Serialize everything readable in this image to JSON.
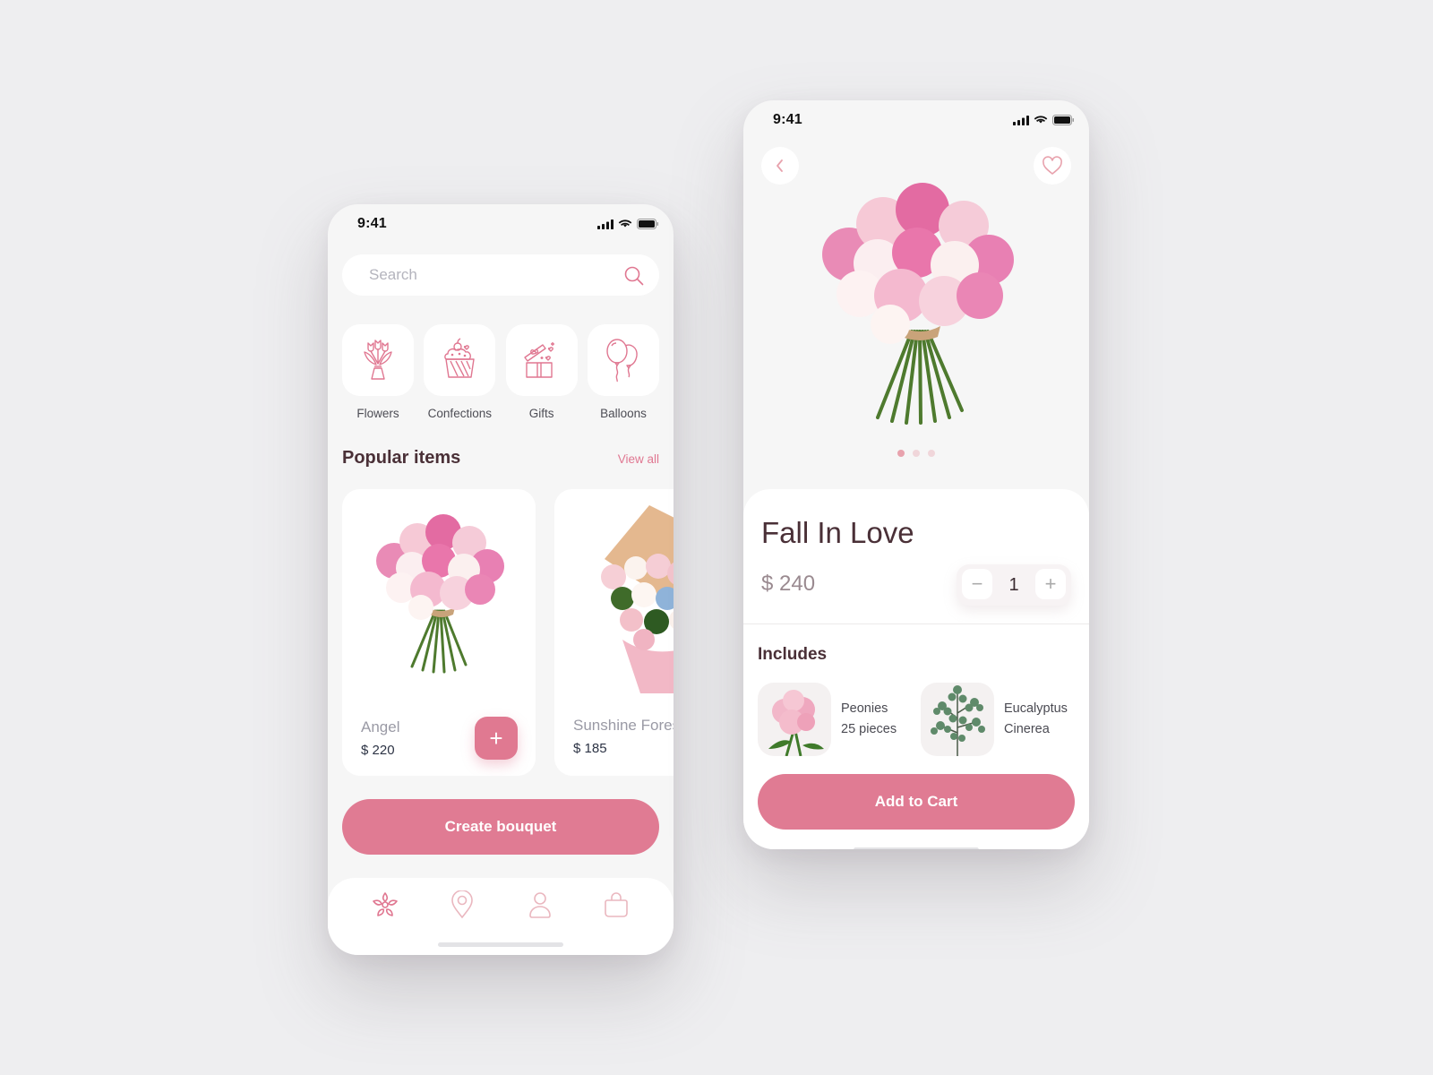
{
  "theme": {
    "accent": "#e07b93",
    "accent_light": "#f0d6da",
    "text_dark": "#4a3037",
    "background": "#eeeef0"
  },
  "home": {
    "status_bar": {
      "time": "9:41",
      "icons": [
        "signal-icon",
        "wifi-icon",
        "battery-icon"
      ]
    },
    "search": {
      "value": "",
      "placeholder": "Search",
      "icon": "search-icon"
    },
    "categories": [
      {
        "label": "Flowers",
        "icon": "bouquet-icon"
      },
      {
        "label": "Confections",
        "icon": "cupcake-icon"
      },
      {
        "label": "Gifts",
        "icon": "gift-box-icon"
      },
      {
        "label": "Balloons",
        "icon": "balloons-icon"
      }
    ],
    "popular": {
      "title": "Popular items",
      "view_all": "View all",
      "items": [
        {
          "name": "Angel",
          "price": "$ 220",
          "add_label": "+"
        },
        {
          "name": "Sunshine Forest",
          "price": "$ 185"
        }
      ]
    },
    "create_button": "Create bouquet",
    "tabbar": [
      {
        "name": "home",
        "icon": "flower-icon",
        "active": true
      },
      {
        "name": "location",
        "icon": "map-pin-icon",
        "active": false
      },
      {
        "name": "profile",
        "icon": "user-icon",
        "active": false
      },
      {
        "name": "cart",
        "icon": "shopping-bag-icon",
        "active": false
      }
    ]
  },
  "detail": {
    "status_bar": {
      "time": "9:41",
      "icons": [
        "signal-icon",
        "wifi-icon",
        "battery-icon"
      ]
    },
    "back_icon": "chevron-left-icon",
    "favorite_icon": "heart-icon",
    "carousel": {
      "count": 3,
      "active_index": 0
    },
    "title": "Fall In Love",
    "price": "$ 240",
    "quantity": {
      "minus": "−",
      "value": "1",
      "plus": "+"
    },
    "includes": {
      "title": "Includes",
      "items": [
        {
          "line1": "Peonies",
          "line2": "25 pieces"
        },
        {
          "line1": "Eucalyptus",
          "line2": "Cinerea"
        }
      ]
    },
    "add_to_cart": "Add to Cart"
  }
}
